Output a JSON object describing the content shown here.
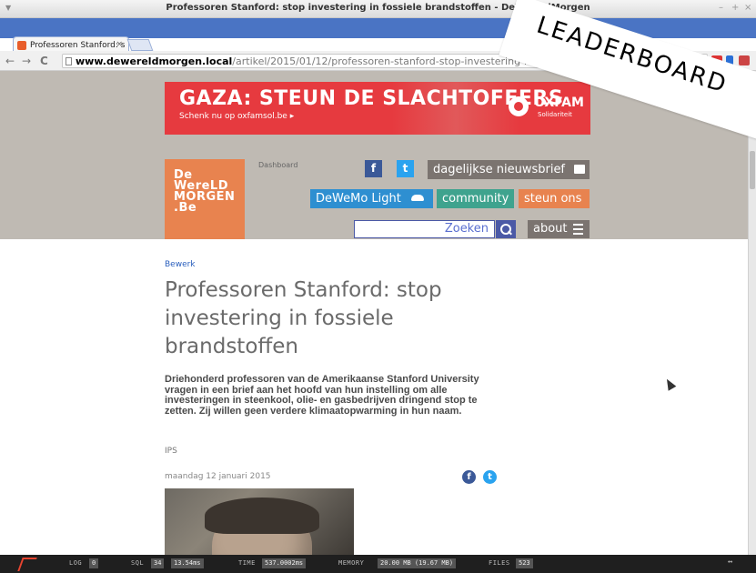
{
  "window": {
    "title": "Professoren Stanford: stop investering in fossiele brandstoffen - DeWereldMorgen"
  },
  "tab": {
    "label": "Professoren Stanford: s"
  },
  "address_bar": {
    "host": "www.dewereldmorgen.local",
    "path": "/artikel/2015/01/12/professoren-stanford-stop-investering-in-fossiele-brandst"
  },
  "overlay_banner": {
    "label": "LEADERBOARD"
  },
  "ad": {
    "headline": "GAZA: STEUN DE SLACHTOFFERS",
    "subline": "Schenk nu op oxfamsol.be ▸",
    "brand": "OXFAM",
    "brand_sub": "Solidariteit"
  },
  "site": {
    "logo_lines": [
      "De",
      "WereLD",
      "MORGEN",
      ".Be"
    ],
    "dashboard_label": "Dashboard",
    "newsletter_label": "dagelijkse nieuwsbrief",
    "light_label": "DeWeMo Light",
    "community_label": "community",
    "support_label": "steun ons",
    "search_placeholder": "Zoeken",
    "about_label": "about"
  },
  "article": {
    "edit_label": "Bewerk",
    "title": "Professoren Stanford: stop investering in fossiele brandstoffen",
    "lead": "Driehonderd professoren van de Amerikaanse Stanford University vragen in een brief aan het hoofd van hun instelling om alle investeringen in steenkool, olie- en gasbedrijven dringend stop te zetten. Zij willen geen verdere klimaatopwarming in hun naam.",
    "source": "IPS",
    "date": "maandag 12 januari 2015"
  },
  "debugbar": {
    "log_label": "LOG",
    "log_value": "0",
    "sql_label": "SQL",
    "sql_count": "34",
    "sql_time": "13.54ms",
    "time_label": "TIME",
    "time_value": "537.0002ms",
    "memory_label": "MEMORY",
    "memory_value": "20.00 MB (19.67 MB)",
    "files_label": "FILES",
    "files_value": "523",
    "expand_label": "↔"
  },
  "colors": {
    "header_bg": "#bfbab3",
    "accent_orange": "#e8834f",
    "accent_blue": "#4b59a6",
    "community_green": "#3fa38e",
    "ad_red": "#e63a3f"
  }
}
